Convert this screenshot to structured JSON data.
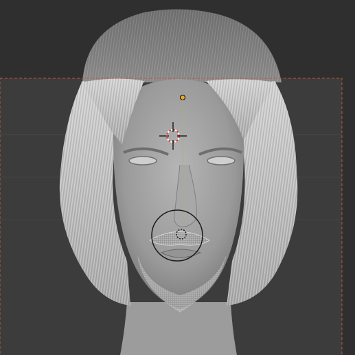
{
  "app": {
    "name": "",
    "view": "3D Viewport"
  },
  "viewport": {
    "background_color": "#3c3c3c",
    "grid_color": "#484848",
    "camera_frame_color": "#c0553f",
    "camera_label": "",
    "objects": [
      {
        "name": "head-mesh",
        "icon": "mesh-icon"
      },
      {
        "name": "hair-mesh",
        "icon": "hair-icon"
      },
      {
        "name": "beard-mesh",
        "icon": "hair-icon"
      }
    ],
    "gizmos": {
      "origin_point_color": "#f5a623",
      "cursor_ring_colors": [
        "#d43a3a",
        "#ffffff"
      ],
      "brush_circle_color": "#1a1a1a"
    }
  }
}
